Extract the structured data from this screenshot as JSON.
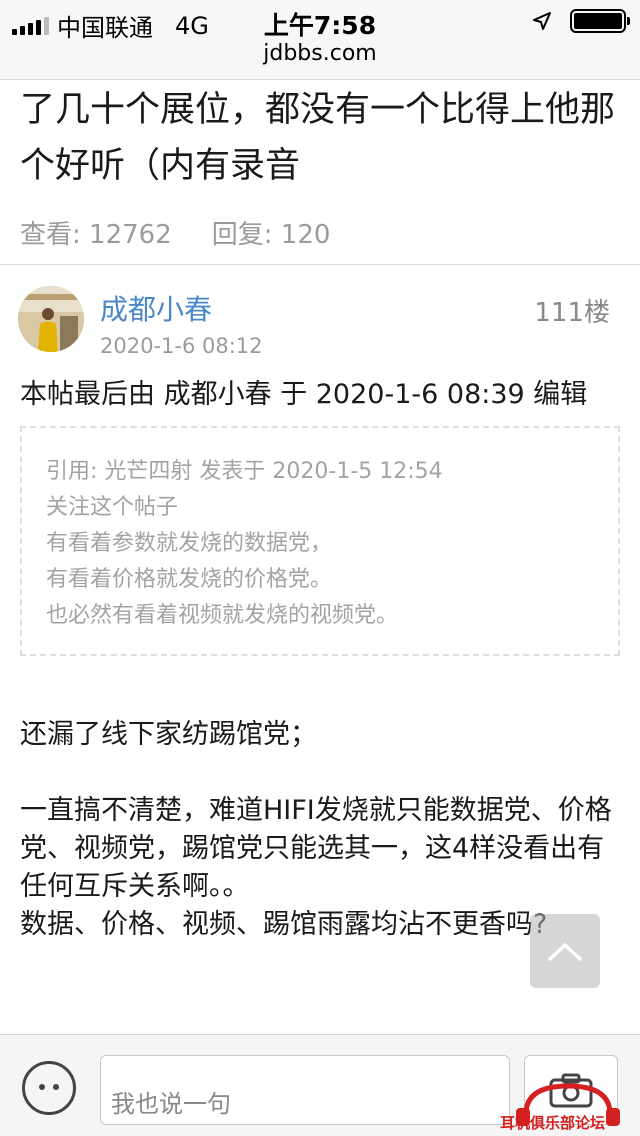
{
  "status_bar": {
    "carrier": "中国联通",
    "network": "4G",
    "time": "上午7:58"
  },
  "url": "jdbbs.com",
  "thread": {
    "title": "了几十个展位，都没有一个比得上他那个好听（内有录音",
    "views_label": "查看: 12762",
    "replies_label": "回复: 120"
  },
  "post": {
    "username": "成都小春",
    "time": "2020-1-6 08:12",
    "floor": "111楼",
    "edit_note": "本帖最后由 成都小春 于 2020-1-6 08:39 编辑",
    "quote": {
      "header": "引用: 光芒四射 发表于 2020-1-5 12:54",
      "lines": [
        "关注这个帖子",
        "有看着参数就发烧的数据党，",
        "有看着价格就发烧的价格党。",
        "也必然有看着视频就发烧的视频党。"
      ]
    },
    "paragraphs": [
      "还漏了线下家纺踢馆党；",
      "一直搞不清楚，难道HIFI发烧就只能数据党、价格党、视频党，踢馆党只能选其一，这4样没看出有任何互斥关系啊。。",
      "数据、价格、视频、踢馆雨露均沾不更香吗?"
    ]
  },
  "bottom_bar": {
    "input_placeholder": "我也说一句",
    "emoji_icon": "smiley-icon",
    "camera_icon": "camera-icon"
  },
  "watermark": {
    "text": "耳机俱乐部论坛"
  },
  "colors": {
    "link": "#4a88c8",
    "muted": "#9b9b9b",
    "watermark": "#d42020"
  }
}
